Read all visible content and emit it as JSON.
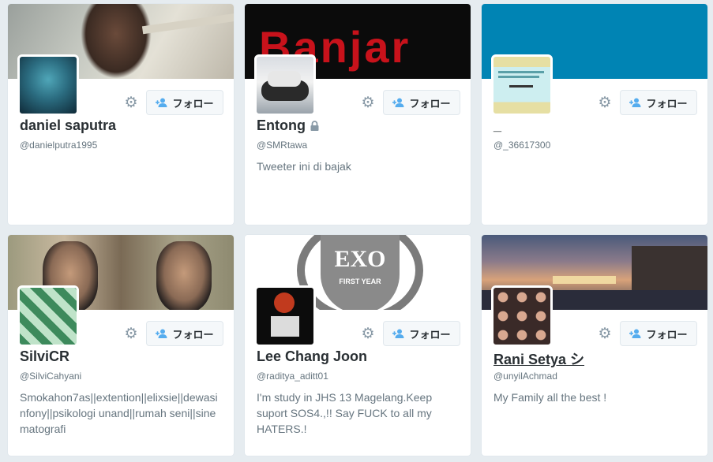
{
  "follow_label": "フォロー",
  "cards": [
    {
      "name": "daniel saputra",
      "handle": "@danielputra1995",
      "bio": ""
    },
    {
      "name": "Entong",
      "handle": "@SMRtawa",
      "bio": "Tweeter ini di bajak",
      "protected": true,
      "banner_text": "Banjar"
    },
    {
      "name": "_",
      "handle": "@_36617300",
      "bio": ""
    },
    {
      "name": "SilviCR",
      "handle": "@SilviCahyani",
      "bio": "Smokahon7as||extention||elixsie||dewasinfony||psikologi unand||rumah seni||sinematografi"
    },
    {
      "name": "Lee Chang Joon",
      "handle": "@raditya_aditt01",
      "bio": "I'm study in JHS 13 Magelang.Keep suport SOS4.,!! Say FUCK to all my HATERS.!",
      "banner_text": "EXO",
      "banner_subtext": "FIRST YEAR"
    },
    {
      "name": "Rani Setya シ",
      "handle": "@unyilAchmad",
      "bio": "My Family all the best !"
    }
  ]
}
